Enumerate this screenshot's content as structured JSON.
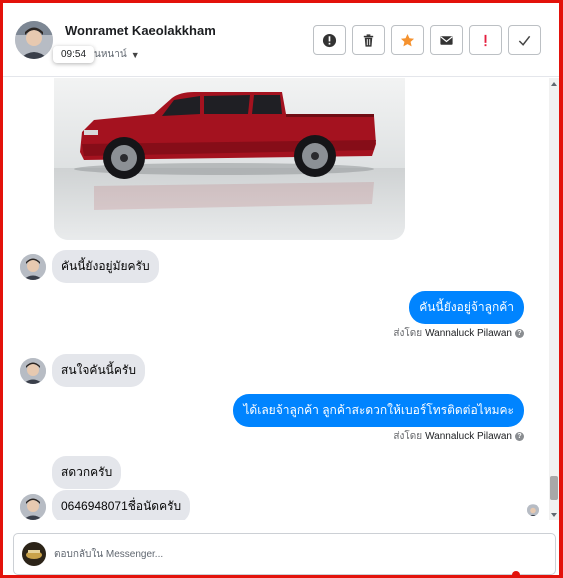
{
  "header": {
    "contact_name": "Wonramet Kaeolakkham",
    "subline": "ยการสนหนาน์",
    "tooltip_time": "09:54",
    "actions": [
      {
        "name": "report",
        "icon": "alert-icon"
      },
      {
        "name": "delete",
        "icon": "trash-icon"
      },
      {
        "name": "star",
        "icon": "star-icon"
      },
      {
        "name": "mail",
        "icon": "mail-icon"
      },
      {
        "name": "spam",
        "icon": "exclamation-icon"
      },
      {
        "name": "done",
        "icon": "check-icon"
      }
    ]
  },
  "messages": [
    {
      "direction": "in",
      "text": "คันนี้ยังอยู่มัยครับ"
    },
    {
      "direction": "out",
      "text": "คันนี้ยังอยู่จ้าลูกค้า",
      "sent_by_prefix": "ส่งโดย",
      "sent_by": "Wannaluck Pilawan"
    },
    {
      "direction": "in",
      "text": "สนใจคันนี้ครับ"
    },
    {
      "direction": "out",
      "text": "ได้เลยจ้าลูกค้า   ลูกค้าสะดวกให้เบอร์โทรติดต่อไหมคะ",
      "sent_by_prefix": "ส่งโดย",
      "sent_by": "Wannaluck Pilawan"
    },
    {
      "direction": "in",
      "text": "สดวกครับ"
    },
    {
      "direction": "in",
      "text": "0646948071ชื่อนัดครับ"
    }
  ],
  "composer": {
    "placeholder": "ตอบกลับใน Messenger..."
  },
  "colors": {
    "outgoing_bubble": "#0084ff",
    "incoming_bubble": "#e4e6eb",
    "star": "#f5922f",
    "spam": "#e41e3f",
    "frame": "#e3120b"
  }
}
